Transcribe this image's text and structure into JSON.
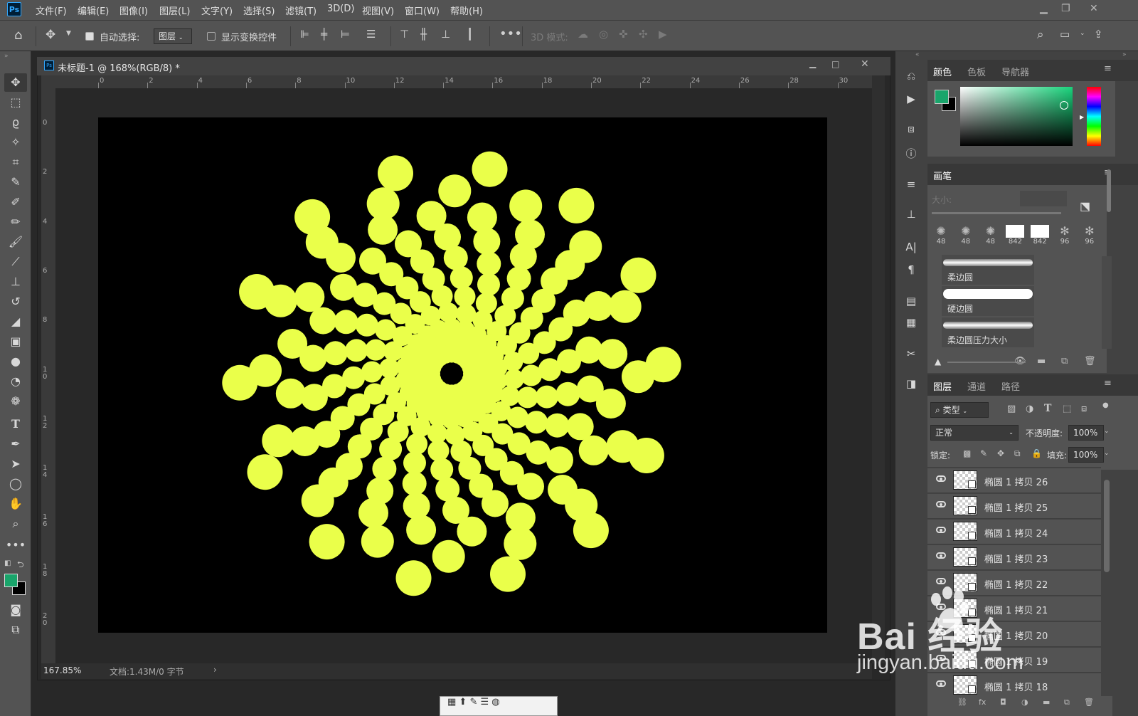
{
  "menubar": {
    "logo": "Ps",
    "items": [
      "文件(F)",
      "编辑(E)",
      "图像(I)",
      "图层(L)",
      "文字(Y)",
      "选择(S)",
      "滤镜(T)",
      "3D(D)",
      "视图(V)",
      "窗口(W)",
      "帮助(H)"
    ]
  },
  "options": {
    "auto_select_label": "自动选择:",
    "auto_select_checked": true,
    "auto_select_target": "图层",
    "show_transform_label": "显示变换控件",
    "show_transform_checked": false,
    "mode_3d_label": "3D 模式:"
  },
  "document": {
    "tab_title": "未标题-1 @ 168%(RGB/8) *",
    "ruler_h": [
      "0",
      "2",
      "4",
      "6",
      "8",
      "10",
      "12",
      "14",
      "16",
      "18",
      "20",
      "22",
      "24",
      "26",
      "28",
      "30"
    ],
    "ruler_v": [
      "0",
      "2",
      "4",
      "6",
      "8",
      "10",
      "12",
      "14",
      "16",
      "18",
      "20"
    ],
    "zoom": "167.85%",
    "doc_info": "文档:1.43M/0 字节",
    "canvas_bg": "#000000",
    "dot_color": "#eaff4a"
  },
  "colors": {
    "foreground": "#19a56b",
    "background": "#000000"
  },
  "color_panel": {
    "tabs": [
      "颜色",
      "色板",
      "导航器"
    ],
    "active_tab": "颜色"
  },
  "brush_panel": {
    "title": "画笔",
    "size_label": "大小:",
    "presets": [
      "48",
      "48",
      "48",
      "842",
      "842",
      "96",
      "96"
    ],
    "brushes": [
      "柔边圆",
      "硬边圆",
      "柔边圆压力大小"
    ]
  },
  "layers_panel": {
    "tabs": [
      "图层",
      "通道",
      "路径"
    ],
    "active_tab": "图层",
    "filter_label": "类型",
    "blend_mode": "正常",
    "opacity_label": "不透明度:",
    "opacity_value": "100%",
    "lock_label": "锁定:",
    "fill_label": "填充:",
    "fill_value": "100%",
    "layers": [
      "椭圆 1 拷贝 26",
      "椭圆 1 拷贝 25",
      "椭圆 1 拷贝 24",
      "椭圆 1 拷贝 23",
      "椭圆 1 拷贝 22",
      "椭圆 1 拷贝 21",
      "椭圆 1 拷贝 20",
      "椭圆 1 拷贝 19",
      "椭圆 1 拷贝 18"
    ]
  },
  "watermark": {
    "brand": "Bai 经验",
    "url": "jingyan.baidu.com"
  }
}
